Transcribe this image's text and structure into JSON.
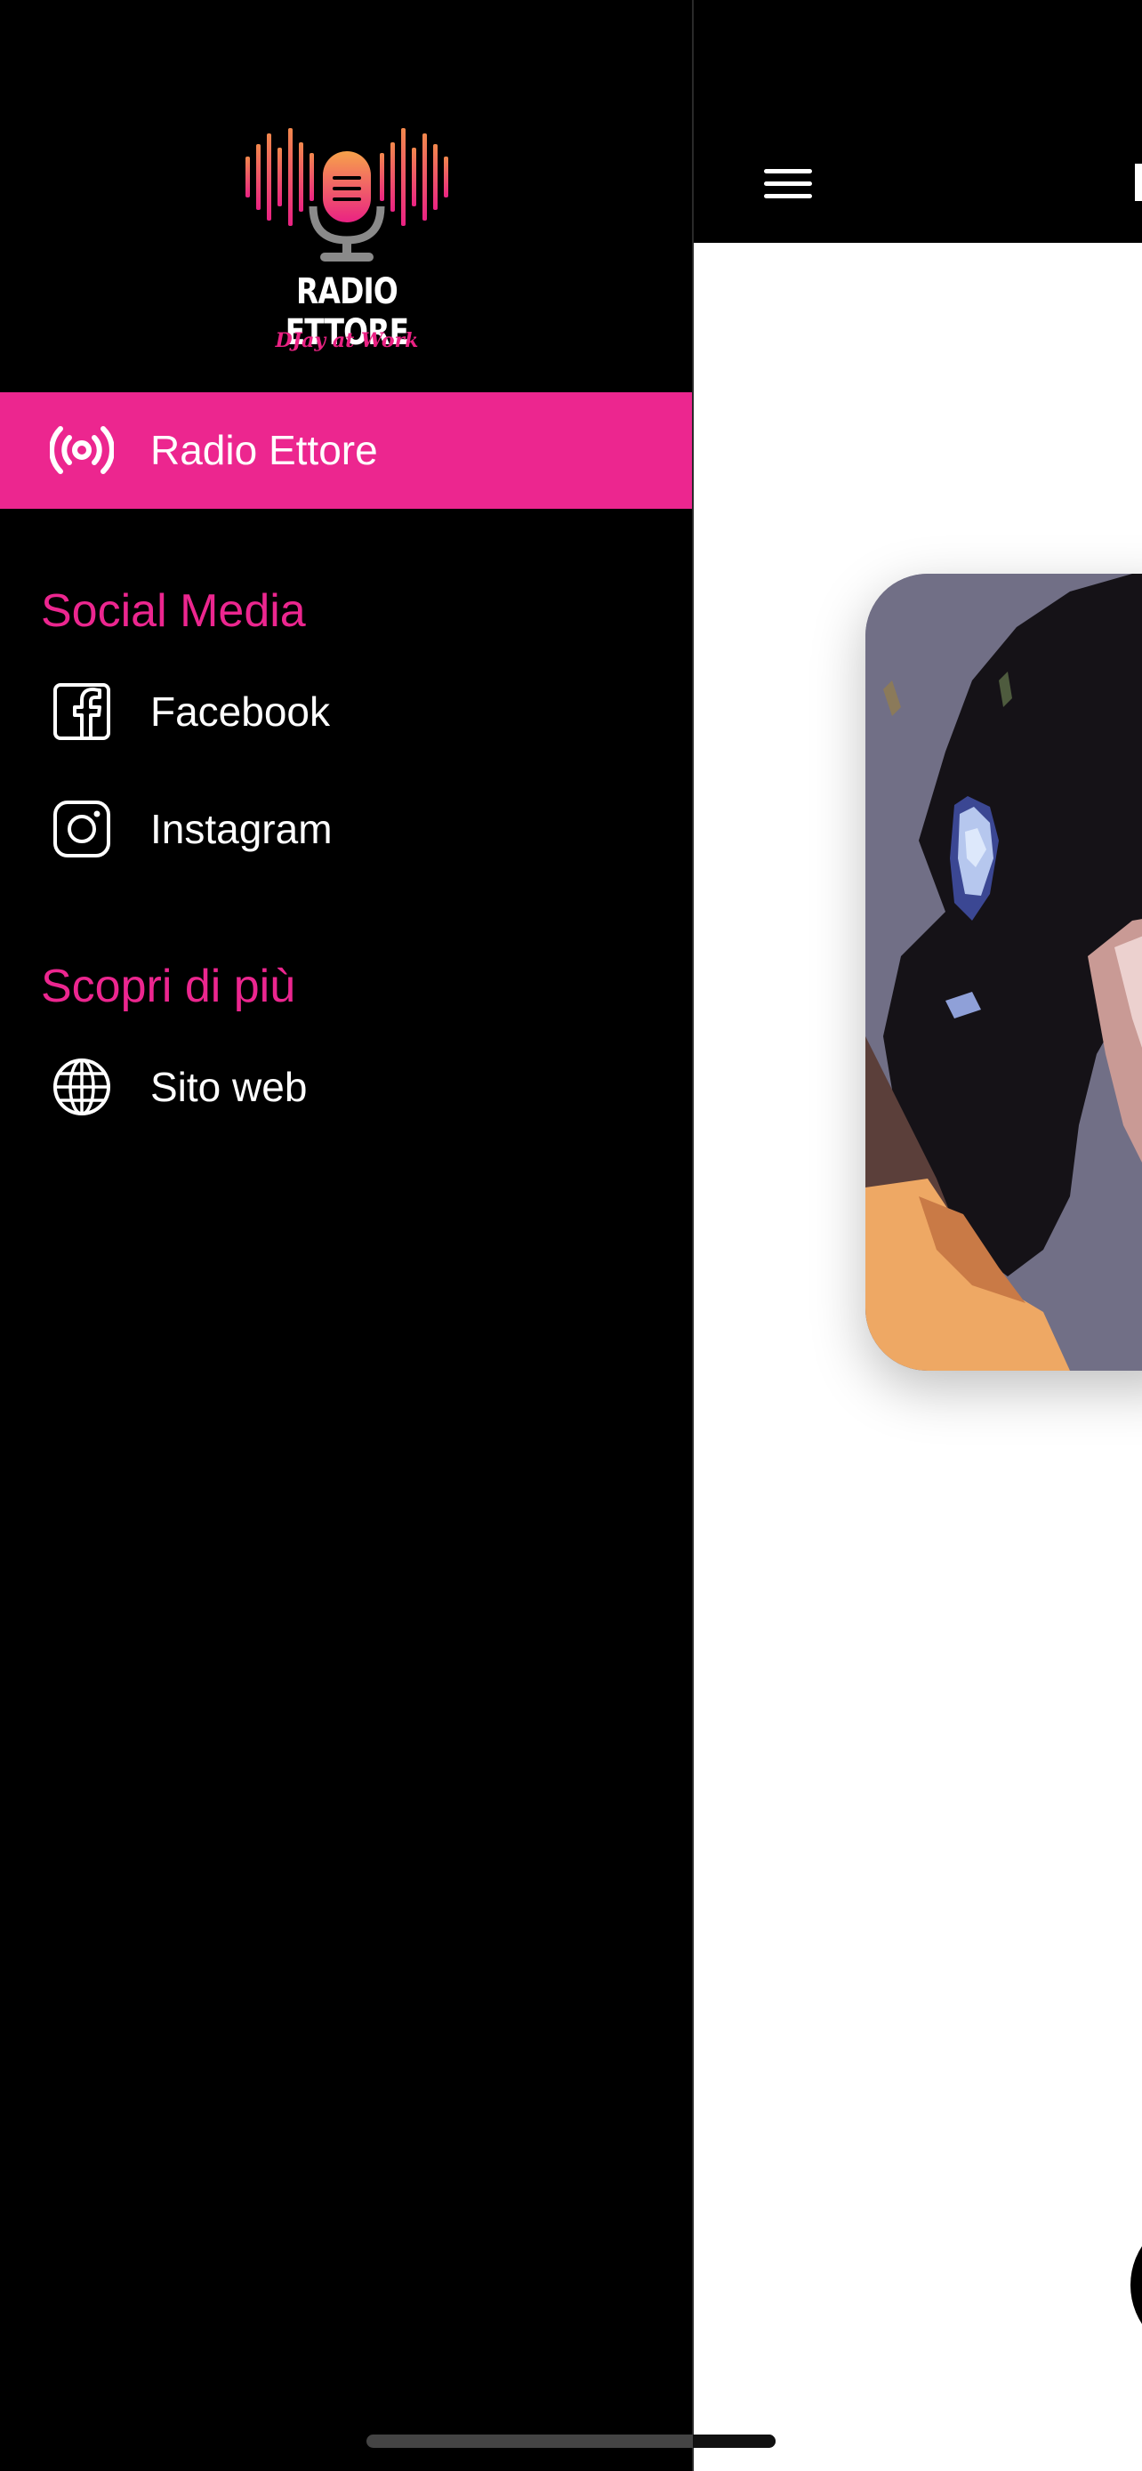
{
  "drawer": {
    "logo": {
      "title": "RADIO ETTORE",
      "tagline": "DJay at Work"
    },
    "active_item": {
      "label": "Radio Ettore",
      "icon": "broadcast-icon"
    },
    "sections": [
      {
        "title": "Social Media",
        "items": [
          {
            "label": "Facebook",
            "icon": "facebook-icon"
          },
          {
            "label": "Instagram",
            "icon": "instagram-icon"
          }
        ]
      },
      {
        "title": "Scopri di più",
        "items": [
          {
            "label": "Sito web",
            "icon": "globe-icon"
          }
        ]
      }
    ]
  },
  "main": {
    "menu_icon": "hamburger-menu-icon",
    "artwork": "cover-art-image"
  },
  "colors": {
    "accent": "#ec268f",
    "background": "#000000",
    "text": "#ffffff",
    "content_background": "#ffffff"
  }
}
